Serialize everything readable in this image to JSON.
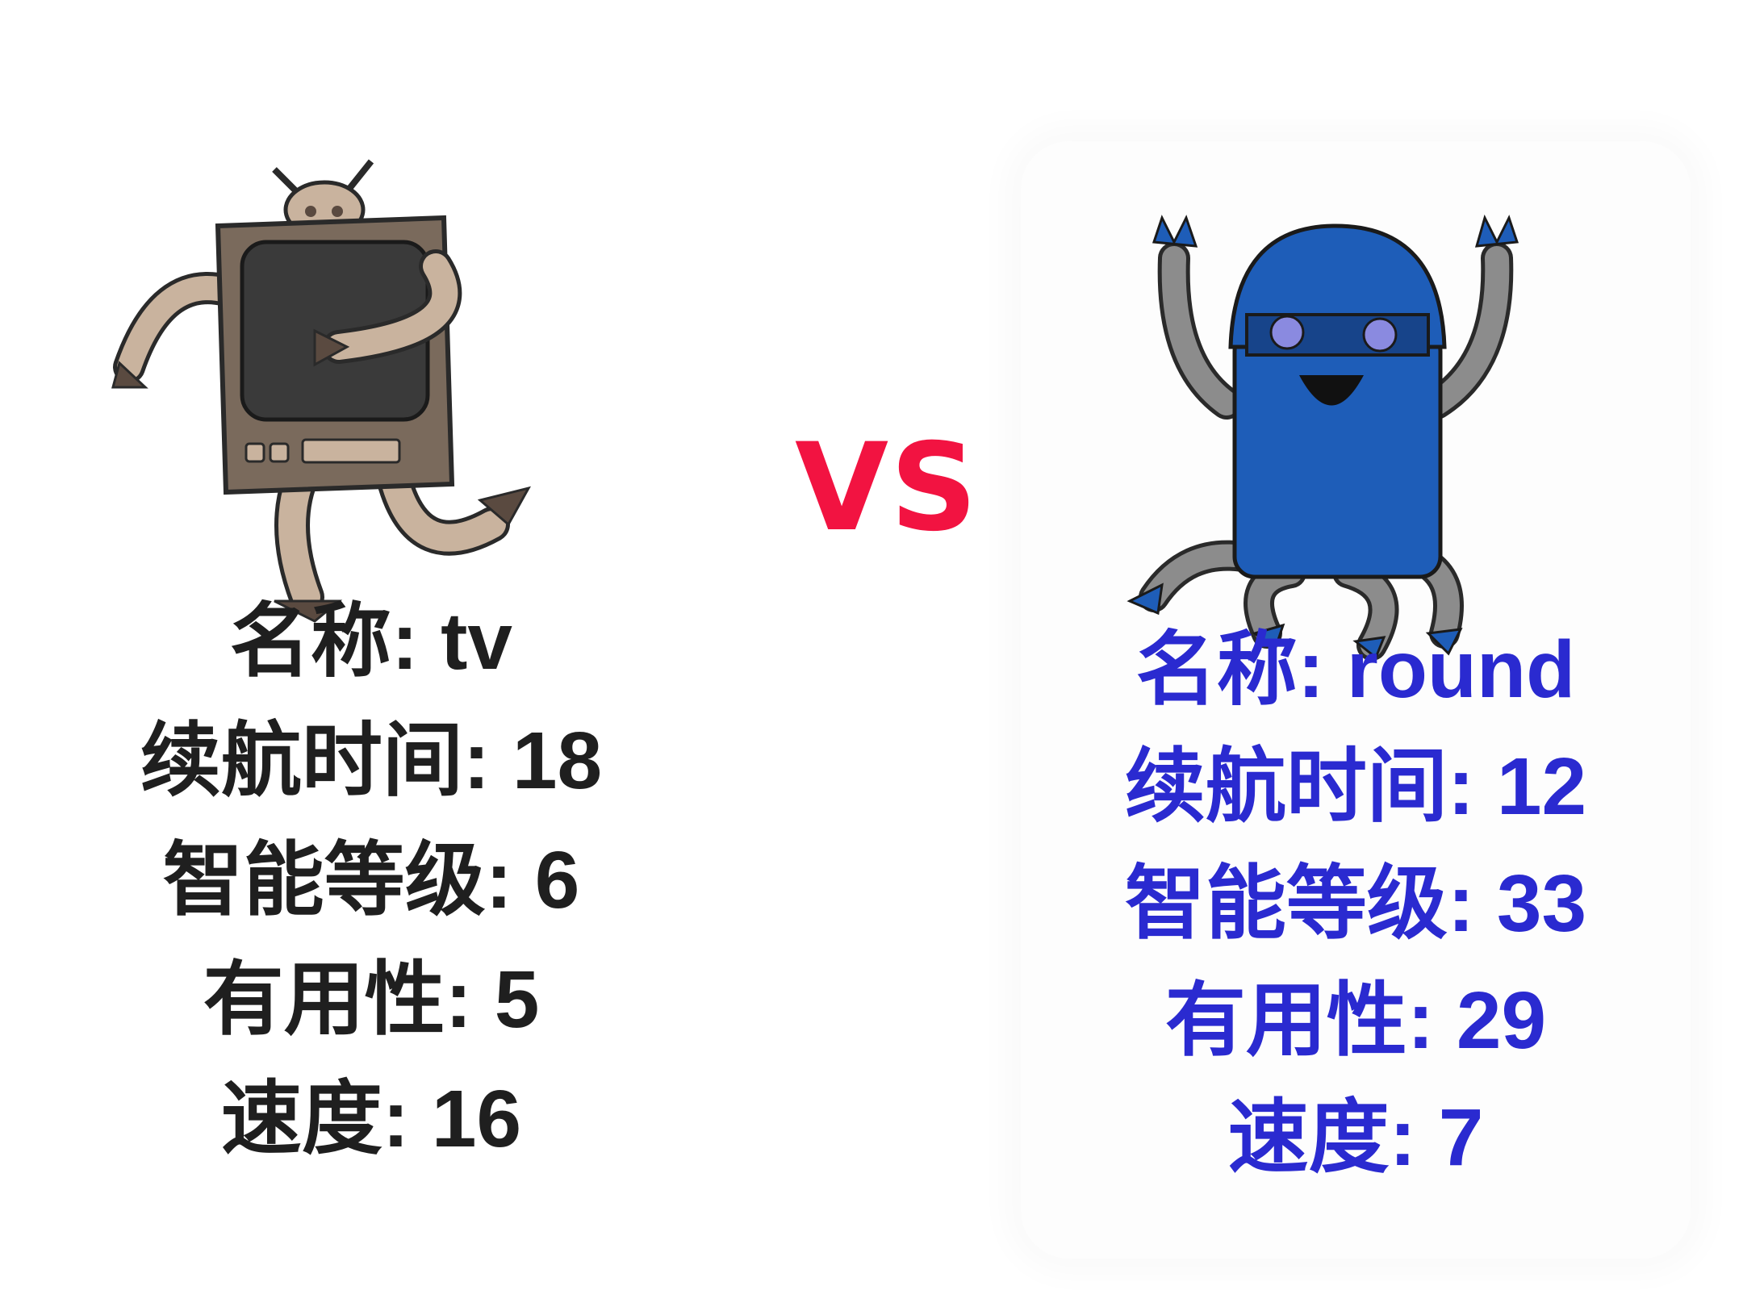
{
  "vs_label": "VS",
  "colors": {
    "vs": "#f21341",
    "left_text": "#1f1f1f",
    "right_text": "#2a2ad0",
    "tv_body": "#7a6a5c",
    "tv_screen": "#3a3a3a",
    "tv_limbs": "#c9b39e",
    "round_body": "#1e5db8",
    "round_limbs": "#8c8c8c"
  },
  "left_robot": {
    "icon": "tv-robot-icon",
    "name_line": "名称: tv",
    "stats": [
      "续航时间: 18",
      "智能等级: 6",
      "有用性: 5",
      "速度: 16"
    ]
  },
  "right_robot": {
    "icon": "round-robot-icon",
    "name_line": "名称: round",
    "stats": [
      "续航时间: 12",
      "智能等级: 33",
      "有用性: 29",
      "速度: 7"
    ]
  }
}
